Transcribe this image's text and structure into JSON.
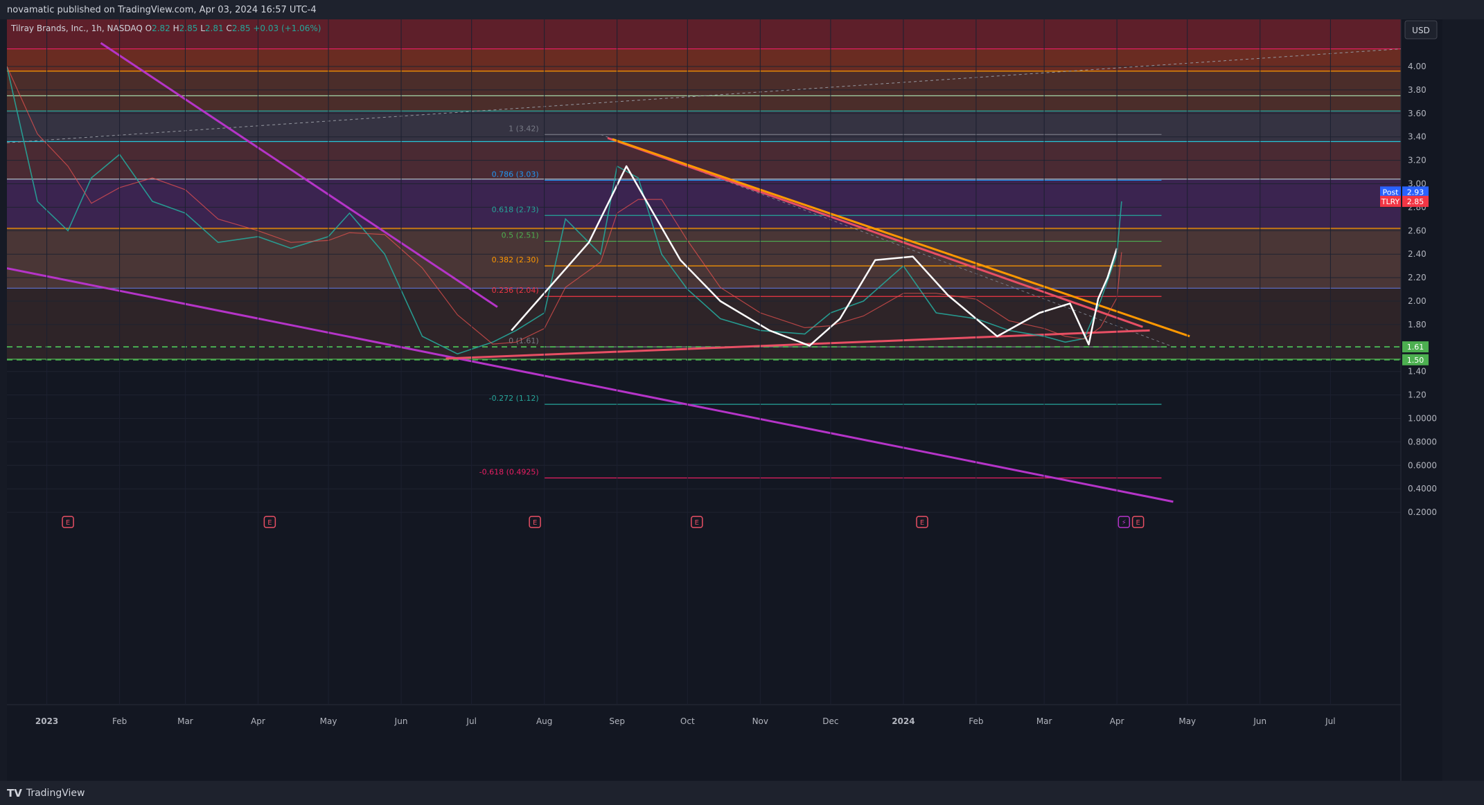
{
  "header": {
    "publisher": "novamatic published on TradingView.com, Apr 03, 2024 16:57 UTC-4"
  },
  "legend": {
    "symbol": "Tilray Brands, Inc., 1h, NASDAQ",
    "open_label": "O",
    "open": "2.82",
    "high_label": "H",
    "high": "2.85",
    "low_label": "L",
    "low": "2.81",
    "close_label": "C",
    "close": "2.85",
    "change": "+0.03 (+1.06%)"
  },
  "currency": "USD",
  "footer": {
    "brand": "TradingView"
  },
  "colors": {
    "background": "#131722",
    "bull": "#26a69a",
    "bear": "#ef5350",
    "fib_grey": "#787b86",
    "fib_blue": "#2962ff",
    "orange": "#ff9800",
    "purple": "#b534c8",
    "white": "#ffffff",
    "green_dash": "#4caf50"
  },
  "chart_data": {
    "type": "line",
    "title": "",
    "ylim": [
      0.2,
      4.1
    ],
    "y_scale": "log",
    "y_tick_labels": [
      "4.00",
      "3.80",
      "3.60",
      "3.40",
      "3.20",
      "3.00",
      "2.80",
      "2.60",
      "2.40",
      "2.20",
      "2.00",
      "1.80",
      "1.60",
      "1.40",
      "1.20",
      "1.0000",
      "0.8000",
      "0.6000",
      "0.4000",
      "0.2000"
    ],
    "x_tick_labels": [
      "2023",
      "Feb",
      "Mar",
      "Apr",
      "May",
      "Jun",
      "Jul",
      "Aug",
      "Sep",
      "Oct",
      "Nov",
      "Dec",
      "2024",
      "Feb",
      "Mar",
      "Apr",
      "May",
      "Jun",
      "Jul"
    ],
    "x_range": [
      "2022-12-15",
      "2024-07-31"
    ],
    "grid": true,
    "price_series": {
      "name": "TLRY",
      "x": [
        "2022-12-15",
        "2022-12-28",
        "2023-01-10",
        "2023-01-20",
        "2023-02-01",
        "2023-02-15",
        "2023-03-01",
        "2023-03-15",
        "2023-04-01",
        "2023-04-15",
        "2023-05-01",
        "2023-05-10",
        "2023-05-25",
        "2023-06-10",
        "2023-06-25",
        "2023-07-10",
        "2023-07-20",
        "2023-08-01",
        "2023-08-10",
        "2023-08-25",
        "2023-09-01",
        "2023-09-10",
        "2023-09-20",
        "2023-10-01",
        "2023-10-15",
        "2023-11-01",
        "2023-11-20",
        "2023-12-01",
        "2023-12-15",
        "2024-01-01",
        "2024-01-15",
        "2024-02-01",
        "2024-02-15",
        "2024-03-01",
        "2024-03-10",
        "2024-03-18",
        "2024-03-25",
        "2024-04-01",
        "2024-04-03"
      ],
      "values": [
        4.0,
        2.85,
        2.6,
        3.05,
        3.25,
        2.85,
        2.75,
        2.5,
        2.55,
        2.45,
        2.55,
        2.75,
        2.4,
        1.7,
        1.55,
        1.65,
        1.75,
        1.9,
        2.7,
        2.4,
        3.15,
        3.05,
        2.4,
        2.1,
        1.85,
        1.75,
        1.72,
        1.9,
        2.0,
        2.3,
        1.9,
        1.85,
        1.75,
        1.7,
        1.65,
        1.68,
        2.0,
        2.4,
        2.85
      ]
    },
    "price_labels": [
      {
        "label": "Post",
        "value": 2.93,
        "color": "#2962ff"
      },
      {
        "label": "TLRY",
        "value": 2.85,
        "color": "#f23645"
      },
      {
        "label": "",
        "value": 1.61,
        "color": "#4caf50"
      },
      {
        "label": "",
        "value": 1.5,
        "color": "#4caf50"
      }
    ],
    "fib_retracement": [
      {
        "label": "1 (3.42)",
        "value": 3.42,
        "color": "#787b86"
      },
      {
        "label": "0.786 (3.03)",
        "value": 3.03,
        "color": "#2196f3"
      },
      {
        "label": "0.618 (2.73)",
        "value": 2.73,
        "color": "#26a69a"
      },
      {
        "label": "0.5 (2.51)",
        "value": 2.51,
        "color": "#4caf50"
      },
      {
        "label": "0.382 (2.30)",
        "value": 2.3,
        "color": "#ff9800"
      },
      {
        "label": "0.236 (2.04)",
        "value": 2.04,
        "color": "#f23645"
      },
      {
        "label": "0 (1.61)",
        "value": 1.61,
        "color": "#787b86"
      },
      {
        "label": "-0.272 (1.12)",
        "value": 1.12,
        "color": "#26a69a"
      },
      {
        "label": "-0.618 (0.4925)",
        "value": 0.4925,
        "color": "#e91e63"
      }
    ],
    "events": [
      {
        "date": "2023-01-10",
        "label": "E"
      },
      {
        "date": "2023-04-06",
        "label": "E"
      },
      {
        "date": "2023-07-28",
        "label": "E"
      },
      {
        "date": "2023-10-05",
        "label": "E"
      },
      {
        "date": "2024-01-09",
        "label": "E"
      },
      {
        "date": "2024-04-04",
        "label": "⚡"
      },
      {
        "date": "2024-04-10",
        "label": "E"
      }
    ]
  }
}
